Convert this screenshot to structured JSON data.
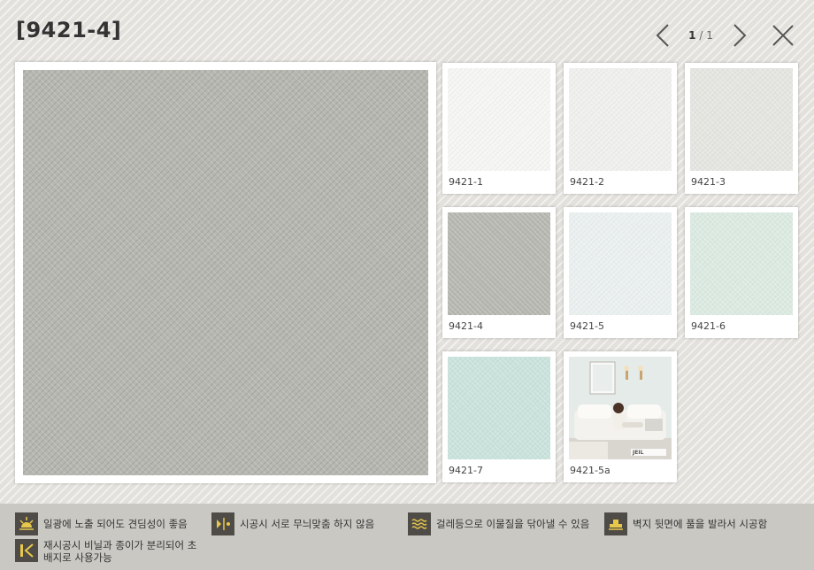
{
  "header": {
    "title": "[9421-4]"
  },
  "pager": {
    "current": "1",
    "total": "1"
  },
  "colors": {
    "main_swatch": "#b7b7b1",
    "footer_bg": "#c9c8c3",
    "icon_bg": "#4f4c47",
    "icon_fg": "#e8c84a"
  },
  "thumbnails": [
    {
      "code": "9421-1",
      "color": "#f5f5f3",
      "type": "swatch"
    },
    {
      "code": "9421-2",
      "color": "#efefed",
      "type": "swatch"
    },
    {
      "code": "9421-3",
      "color": "#e4e4e0",
      "type": "swatch"
    },
    {
      "code": "9421-4",
      "color": "#b7b7b1",
      "type": "swatch"
    },
    {
      "code": "9421-5",
      "color": "#eaf0ef",
      "type": "swatch"
    },
    {
      "code": "9421-6",
      "color": "#dbeae1",
      "type": "swatch"
    },
    {
      "code": "9421-7",
      "color": "#c9e2dc",
      "type": "swatch"
    },
    {
      "code": "9421-5a",
      "color": "#e8ecea",
      "type": "room-photo",
      "brand": "JEIL"
    }
  ],
  "features": [
    {
      "icon": "sun-icon",
      "text": "일광에 노출 되어도 견딤성이 좋음"
    },
    {
      "icon": "pattern-match-icon",
      "text": "시공시 서로 무늬맞춤 하지 않음"
    },
    {
      "icon": "wave-wash-icon",
      "text": "걸레등으로 이물질을 닦아낼 수 있음"
    },
    {
      "icon": "glue-wall-icon",
      "text": "벽지 뒷면에 풀을 발라서 시공함"
    },
    {
      "icon": "peel-layer-icon",
      "line1": "재시공시 비닐과 종이가 분리되어 초",
      "line2": "배지로 사용가능"
    }
  ]
}
